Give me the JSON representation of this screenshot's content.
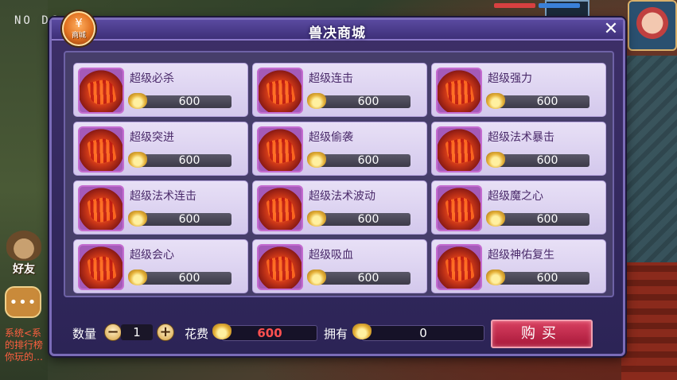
{
  "hud": {
    "top_left_text": "NO DC",
    "friend_label": "好友",
    "chat_icon": "chat-bubble-icon",
    "rank_lines": [
      "系统<系",
      "的排行榜",
      "你玩的…"
    ]
  },
  "dialog": {
    "title": "兽决商城",
    "close_label": "✕",
    "badge_label": "商城",
    "badge_coin": "¥"
  },
  "items": [
    {
      "name": "超级必杀",
      "price": "600"
    },
    {
      "name": "超级连击",
      "price": "600"
    },
    {
      "name": "超级强力",
      "price": "600"
    },
    {
      "name": "超级突进",
      "price": "600"
    },
    {
      "name": "超级偷袭",
      "price": "600"
    },
    {
      "name": "超级法术暴击",
      "price": "600"
    },
    {
      "name": "超级法术连击",
      "price": "600"
    },
    {
      "name": "超级法术波动",
      "price": "600"
    },
    {
      "name": "超级魔之心",
      "price": "600"
    },
    {
      "name": "超级会心",
      "price": "600"
    },
    {
      "name": "超级吸血",
      "price": "600"
    },
    {
      "name": "超级神佑复生",
      "price": "600"
    }
  ],
  "footer": {
    "qty_label": "数量",
    "qty_minus": "−",
    "qty_value": "1",
    "qty_plus": "+",
    "cost_label": "花费",
    "cost_value": "600",
    "own_label": "拥有",
    "own_value": "0",
    "buy_label": "购买"
  },
  "colors": {
    "dialog_bg": "#3d2f68",
    "item_card": "#e8e0f6",
    "buy_button": "#c0284a",
    "cost_text": "#ff5050"
  }
}
